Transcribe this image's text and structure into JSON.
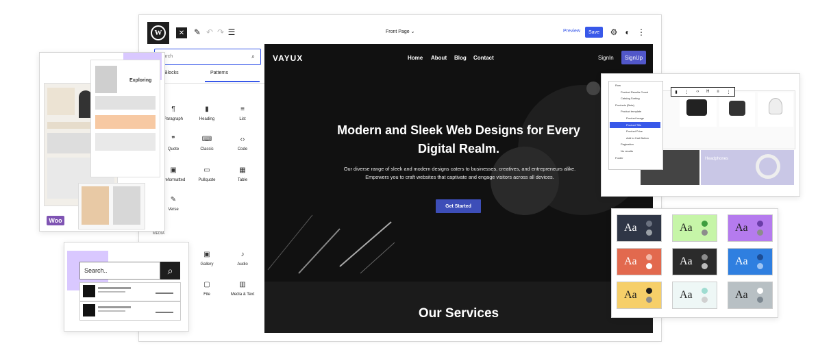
{
  "editor": {
    "toolbar": {
      "close_label": "✕",
      "document_title": "Front Page",
      "preview_label": "Preview",
      "save_label": "Save"
    },
    "inserter": {
      "search_placeholder": "Search",
      "tab_blocks": "Blocks",
      "tab_patterns": "Patterns",
      "blocks": [
        {
          "label": "Paragraph",
          "icon": "paragraph-icon",
          "glyph": "¶"
        },
        {
          "label": "Heading",
          "icon": "bookmark-icon",
          "glyph": "▮"
        },
        {
          "label": "List",
          "icon": "list-icon",
          "glyph": "≡"
        },
        {
          "label": "Quote",
          "icon": "quote-icon",
          "glyph": "❞"
        },
        {
          "label": "Classic",
          "icon": "keyboard-icon",
          "glyph": "⌨"
        },
        {
          "label": "Code",
          "icon": "code-icon",
          "glyph": "‹›"
        },
        {
          "label": "Preformatted",
          "icon": "preformatted-icon",
          "glyph": "▣"
        },
        {
          "label": "Pullquote",
          "icon": "pullquote-icon",
          "glyph": "▭"
        },
        {
          "label": "Table",
          "icon": "table-icon",
          "glyph": "▦"
        },
        {
          "label": "Verse",
          "icon": "verse-icon",
          "glyph": "✎"
        }
      ],
      "media_heading": "MEDIA",
      "media_blocks": [
        {
          "label": "Gallery",
          "icon": "gallery-icon",
          "glyph": "▣"
        },
        {
          "label": "Audio",
          "icon": "audio-icon",
          "glyph": "♪"
        },
        {
          "label": "File",
          "icon": "folder-icon",
          "glyph": "▢"
        },
        {
          "label": "Media & Text",
          "icon": "media-text-icon",
          "glyph": "▥"
        }
      ]
    },
    "site": {
      "brand": "VAYUX",
      "nav": [
        "Home",
        "About",
        "Blog",
        "Contact"
      ],
      "signin": "SignIn",
      "signup": "SignUp",
      "hero_title": "Modern and Sleek Web Designs for Every Digital Realm.",
      "hero_description": "Our diverse range of sleek and modern designs caters to businesses, creatives, and entrepreneurs alike. Empowers you to craft websites that captivate and engage visitors across all devices.",
      "cta_label": "Get Started",
      "services_title": "Our Services"
    }
  },
  "woo_card": {
    "logo_text": "Woo",
    "banner_text": "Exploring"
  },
  "search_card": {
    "placeholder": "Search.."
  },
  "product_card": {
    "tree_items": [
      "Row",
      "Product Results Count",
      "Catalog Sorting",
      "Products (Beta)",
      "Product template",
      "Product Image",
      "Product Title",
      "Product Price",
      "Add to Cart Button",
      "Pagination",
      "No results",
      "Footer"
    ],
    "headphones_label": "Headphones"
  },
  "styles_card": {
    "sample_text": "Aa",
    "swatches": [
      {
        "bg": "#2f3646",
        "fg": "#ffffff",
        "dot1": "#6b7280",
        "dot2": "#9aa0a6"
      },
      {
        "bg": "#c6f5a8",
        "fg": "#1e1e1e",
        "dot1": "#3e9d3e",
        "dot2": "#8c8c8c"
      },
      {
        "bg": "#b57bee",
        "fg": "#1e1e1e",
        "dot1": "#6a3da8",
        "dot2": "#8c8c8c"
      },
      {
        "bg": "#e2694e",
        "fg": "#ffffff",
        "dot1": "#f2b8a8",
        "dot2": "#ffffff"
      },
      {
        "bg": "#2b2b2b",
        "fg": "#ffffff",
        "dot1": "#8c8c8c",
        "dot2": "#bcbcbc"
      },
      {
        "bg": "#2f7fe0",
        "fg": "#ffffff",
        "dot1": "#1d4d94",
        "dot2": "#9ec4f3"
      },
      {
        "bg": "#f6cf69",
        "fg": "#1e1e1e",
        "dot1": "#1e1e1e",
        "dot2": "#8c8c8c"
      },
      {
        "bg": "#eef7f6",
        "fg": "#1e1e1e",
        "dot1": "#9fdcd1",
        "dot2": "#d0d0d0"
      },
      {
        "bg": "#b8c0c4",
        "fg": "#1e1e1e",
        "dot1": "#ffffff",
        "dot2": "#7c8790"
      }
    ]
  }
}
